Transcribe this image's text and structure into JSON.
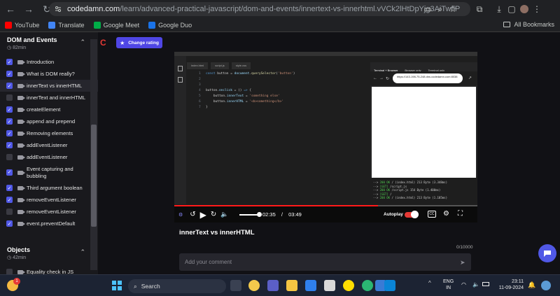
{
  "browser": {
    "url_host": "codedamn.com",
    "url_path": "/learn/advanced-practical-javascript/dom-and-events/innertext-vs-innerhtml.vVCk2lHtDpYjg3AiTwflP",
    "bookmarks": [
      {
        "label": "YouTube",
        "color": "#ff0000"
      },
      {
        "label": "Translate",
        "color": "#4285f4"
      },
      {
        "label": "Google Meet",
        "color": "#00ac47"
      },
      {
        "label": "Google Duo",
        "color": "#1a73e8"
      }
    ],
    "all_bookmarks": "All Bookmarks"
  },
  "sidebar": {
    "sections": [
      {
        "title": "DOM and Events",
        "duration": "82min",
        "items": [
          {
            "label": "Introduction",
            "done": true
          },
          {
            "label": "What is DOM really?",
            "done": true
          },
          {
            "label": "innerText vs innerHTML",
            "done": true,
            "active": true
          },
          {
            "label": "innerText and innerHTML",
            "done": false
          },
          {
            "label": "createElement",
            "done": true
          },
          {
            "label": "append and prepend",
            "done": true
          },
          {
            "label": "Removing elements",
            "done": true
          },
          {
            "label": "addEventListener",
            "done": true
          },
          {
            "label": "addEventListener",
            "done": false
          },
          {
            "label": "Event capturing and bubbling",
            "done": true,
            "two_line": true
          },
          {
            "label": "Third argument boolean",
            "done": true
          },
          {
            "label": "removeEventListener",
            "done": true
          },
          {
            "label": "removeEventListener",
            "done": false
          },
          {
            "label": "event.preventDefault",
            "done": true
          }
        ]
      },
      {
        "title": "Objects",
        "duration": "42min",
        "items": [
          {
            "label": "Equality check in JS",
            "done": false
          }
        ]
      }
    ]
  },
  "main": {
    "change_rating": "Change rating",
    "video_title": "innerText vs innerHTML",
    "char_count": "0/10000",
    "comment_placeholder": "Add your comment"
  },
  "player": {
    "tabs": [
      "index.html",
      "script.js",
      "style.css"
    ],
    "code": [
      {
        "n": "1",
        "html": "<span class='kw'>const</span> button = <span class='pr'>document</span>.<span class='fn'>querySelector</span>(<span class='str'>'button'</span>)"
      },
      {
        "n": "2",
        "html": ""
      },
      {
        "n": "3",
        "html": ""
      },
      {
        "n": "4",
        "html": "button.<span class='pr'>onclick</span> = () <span class='kw'>=&gt;</span> {"
      },
      {
        "n": "5",
        "html": "&nbsp;&nbsp;&nbsp;&nbsp;button.<span class='pr'>innerText</span> = <span class='str'>'something else'</span>"
      },
      {
        "n": "6",
        "html": "&nbsp;&nbsp;&nbsp;&nbsp;button.<span class='pr'>innerHTML</span> = <span class='str'>'&lt;b&gt;something&lt;/b&gt;'</span>"
      },
      {
        "n": "7",
        "html": "}"
      }
    ],
    "preview_tabs": [
      "Terminal + Browser",
      "Browser only",
      "Terminal only"
    ],
    "preview_url": "https://143-198-75-248.dns.codedamn.com:8038",
    "terminal_lines": [
      {
        "status": "200 OK",
        "text": "/ (index.html) 213 Byte (3.348ms)"
      },
      {
        "status": "[GET]",
        "text": "/script.js"
      },
      {
        "status": "200 OK",
        "text": "/script.js 154 Byte (1.400ms)"
      },
      {
        "status": "[GET]",
        "text": "/"
      },
      {
        "status": "200 OK",
        "text": "/ (index.html) 213 Byte (1.105ms)"
      }
    ],
    "current_time": "02:35",
    "separator": "/",
    "duration": "03:49",
    "progress": 0.672,
    "volume": 0.9,
    "autoplay_label": "Autoplay",
    "cc_label": "CC"
  },
  "taskbar": {
    "search_label": "Search",
    "weather_badge": "1",
    "lang_line1": "ENG",
    "lang_line2": "IN",
    "time": "23:11",
    "date": "11-09-2024"
  }
}
